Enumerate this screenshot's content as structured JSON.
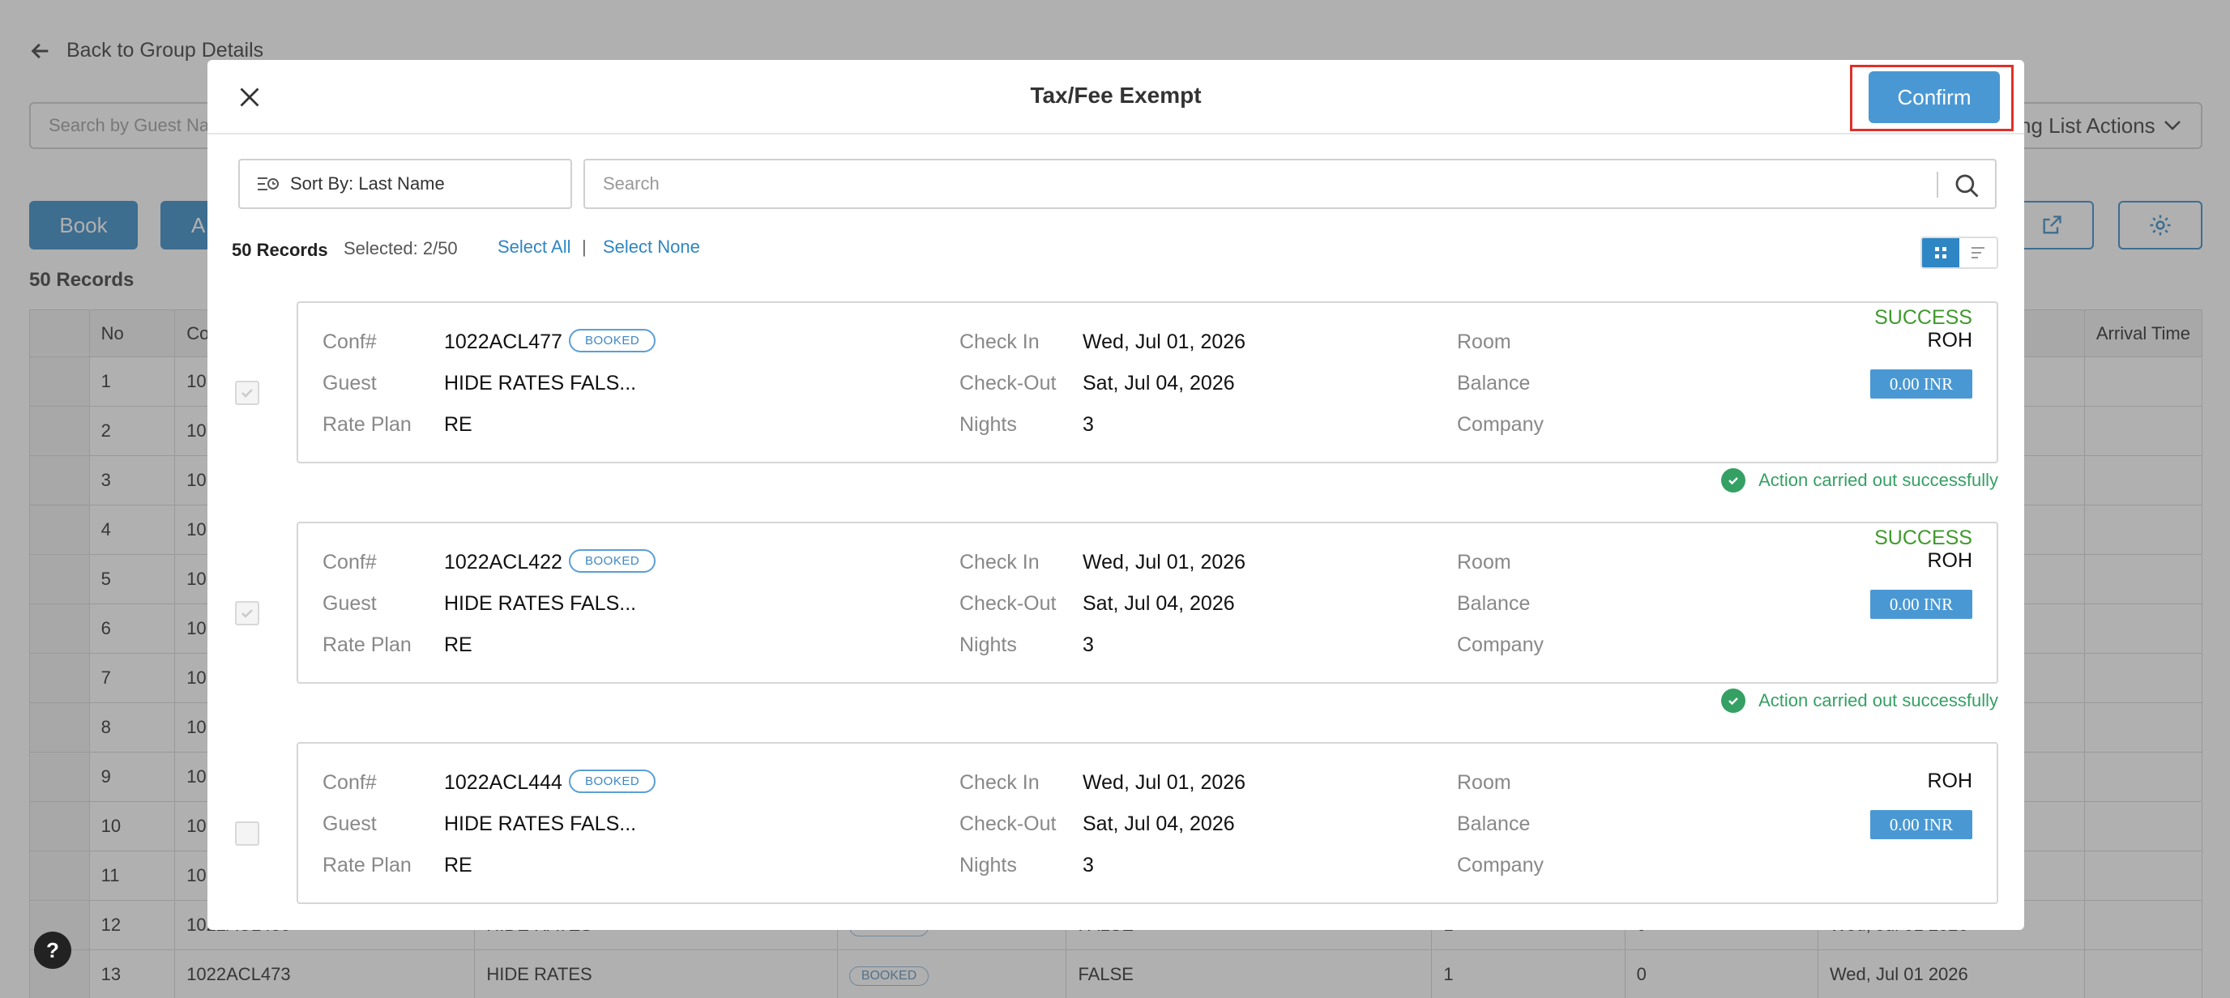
{
  "background": {
    "back_link": "Back to Group Details",
    "search_placeholder": "Search by Guest Nam",
    "actions_label": "ng List Actions",
    "book_button": "Book",
    "add_button": "A",
    "records_label": "50 Records",
    "table": {
      "headers": [
        "",
        "No",
        "Co",
        "",
        "",
        "",
        "",
        "",
        "",
        "Arrival Time"
      ],
      "rows": [
        {
          "no": "1",
          "conf": "10"
        },
        {
          "no": "2",
          "conf": "10"
        },
        {
          "no": "3",
          "conf": "10"
        },
        {
          "no": "4",
          "conf": "10"
        },
        {
          "no": "5",
          "conf": "10"
        },
        {
          "no": "6",
          "conf": "10"
        },
        {
          "no": "7",
          "conf": "10"
        },
        {
          "no": "8",
          "conf": "10"
        },
        {
          "no": "9",
          "conf": "10"
        },
        {
          "no": "10",
          "conf": "10"
        },
        {
          "no": "11",
          "conf": "10"
        },
        {
          "no": "12",
          "conf": "1022ACL430",
          "guest": "HIDE RATES",
          "status": "BOOKED",
          "tax": "FALSE",
          "n1": "1",
          "n2": "0",
          "date": "Wed, Jul 01 2026"
        },
        {
          "no": "13",
          "conf": "1022ACL473",
          "guest": "HIDE RATES",
          "status": "BOOKED",
          "tax": "FALSE",
          "n1": "1",
          "n2": "0",
          "date": "Wed, Jul 01 2026"
        }
      ]
    },
    "help_label": "?"
  },
  "modal": {
    "title": "Tax/Fee Exempt",
    "confirm_label": "Confirm",
    "sort_label": "Sort By: Last Name",
    "search_placeholder": "Search",
    "records_count": "50 Records",
    "selected_count": "Selected: 2/50",
    "select_all": "Select All",
    "separator": "|",
    "select_none": "Select None",
    "field_labels": {
      "conf": "Conf#",
      "guest": "Guest",
      "rate_plan": "Rate Plan",
      "check_in": "Check In",
      "check_out": "Check-Out",
      "nights": "Nights",
      "room": "Room",
      "balance": "Balance",
      "company": "Company"
    },
    "reservations": [
      {
        "conf": "1022ACL477",
        "status": "BOOKED",
        "guest": "HIDE RATES FALS...",
        "rate_plan": "RE",
        "check_in": "Wed, Jul 01, 2026",
        "check_out": "Sat, Jul 04, 2026",
        "nights": "3",
        "result": "SUCCESS",
        "room": "ROH",
        "balance": "0.00 INR",
        "message": "Action carried out successfully",
        "checked": true
      },
      {
        "conf": "1022ACL422",
        "status": "BOOKED",
        "guest": "HIDE RATES FALS...",
        "rate_plan": "RE",
        "check_in": "Wed, Jul 01, 2026",
        "check_out": "Sat, Jul 04, 2026",
        "nights": "3",
        "result": "SUCCESS",
        "room": "ROH",
        "balance": "0.00 INR",
        "message": "Action carried out successfully",
        "checked": true
      },
      {
        "conf": "1022ACL444",
        "status": "BOOKED",
        "guest": "HIDE RATES FALS...",
        "rate_plan": "RE",
        "check_in": "Wed, Jul 01, 2026",
        "check_out": "Sat, Jul 04, 2026",
        "nights": "3",
        "result": "",
        "room": "ROH",
        "balance": "0.00 INR",
        "message": "",
        "checked": false
      }
    ]
  },
  "colors": {
    "accent": "#4a98d3",
    "success": "#3f9a2c",
    "highlight_outline": "#e0302a"
  }
}
